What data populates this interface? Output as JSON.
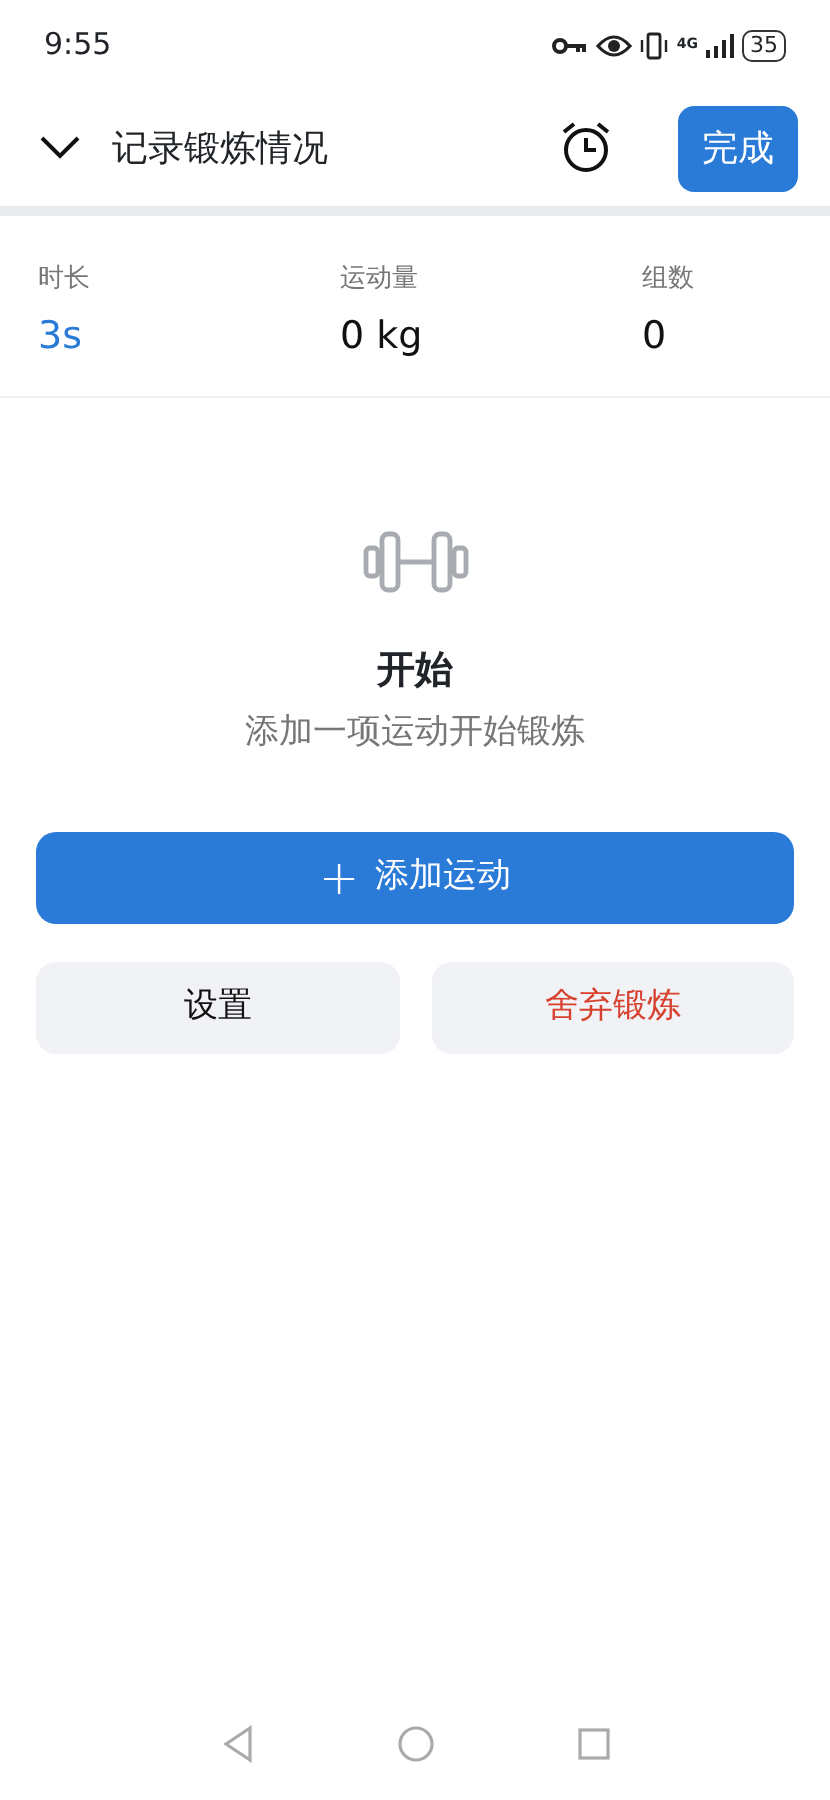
{
  "status_bar": {
    "time": "9:55",
    "network": "4G",
    "battery": "35"
  },
  "header": {
    "title": "记录锻炼情况",
    "finish_button": "完成"
  },
  "stats": [
    {
      "label": "时长",
      "value": "3s",
      "color": "#2a7bd8"
    },
    {
      "label": "运动量",
      "value": "0 kg",
      "color": "#111111"
    },
    {
      "label": "组数",
      "value": "0",
      "color": "#111111"
    }
  ],
  "empty_state": {
    "title": "开始",
    "subtitle": "添加一项运动开始锻炼"
  },
  "add_button": {
    "icon": "+",
    "label": "添加运动"
  },
  "actions": [
    {
      "label": "设置",
      "kind": "normal"
    },
    {
      "label": "舍弃锻炼",
      "kind": "danger"
    }
  ]
}
